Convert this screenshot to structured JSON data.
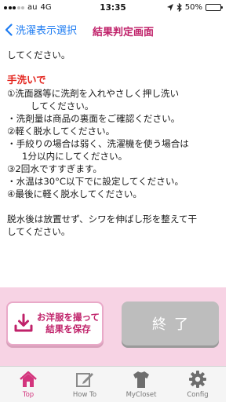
{
  "status_bar": {
    "carrier": "au",
    "network": "4G",
    "time": "13:35",
    "battery": "50%",
    "battery_level": 0.5
  },
  "nav": {
    "back_label": "洗濯表示選択",
    "title": "結果判定画面"
  },
  "content": {
    "intro_tail": "してください。",
    "section_title": "手洗いで",
    "lines": [
      "①洗面器等に洗剤を入れやさしく押し洗い",
      "してください。",
      "・洗剤量は商品の裏面をご確認ください。",
      "②軽く脱水してください。",
      "・手絞りの場合は弱く、洗濯機を使う場合は",
      "1分以内にしてください。",
      "③2回水ですすぎます。",
      "・水温は30°C以下でに設定してください。",
      "④最後に軽く脱水してください。"
    ],
    "closing_line1": "脱水後は放置せず、シワを伸ばし形を整えて干",
    "closing_line2": "してください。"
  },
  "actions": {
    "save_label": "お洋服を撮って\n結果を保存",
    "end_label": "終了"
  },
  "tabs": [
    {
      "label": "Top",
      "icon": "home-icon",
      "active": true
    },
    {
      "label": "How To",
      "icon": "edit-icon",
      "active": false
    },
    {
      "label": "MyCloset",
      "icon": "tshirt-icon",
      "active": false
    },
    {
      "label": "Config",
      "icon": "gear-icon",
      "active": false
    }
  ],
  "colors": {
    "accent": "#c0226a",
    "link": "#1e7cf2",
    "section_title": "#e3231c",
    "action_bg": "#f7d3e4",
    "end_button": "#bdbdbd",
    "tab_active": "#d3357d"
  }
}
